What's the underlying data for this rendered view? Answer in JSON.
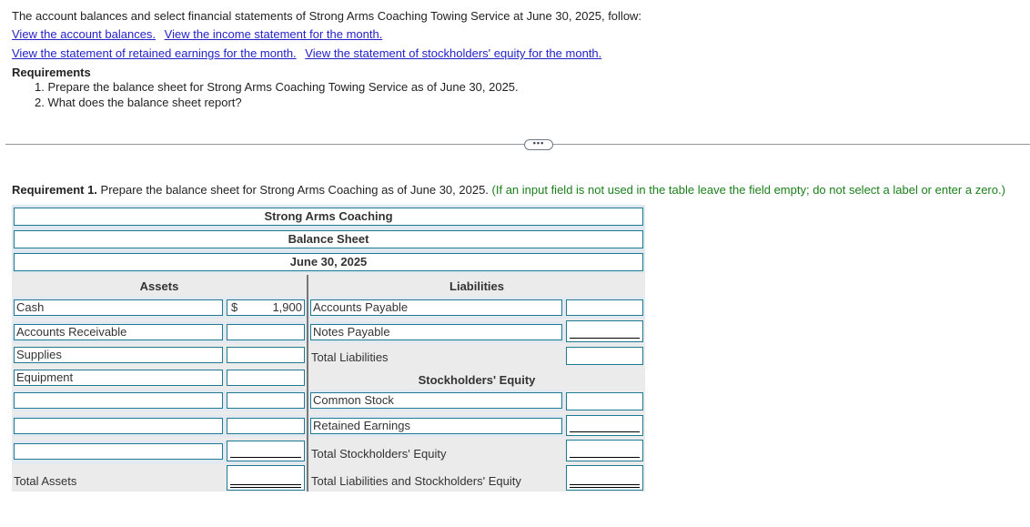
{
  "intro": {
    "text": "The account balances and select financial statements of Strong Arms Coaching Towing Service at June 30, 2025, follow:",
    "links": [
      "View the account balances.",
      "View the income statement for the month.",
      "View the statement of retained earnings for the month.",
      "View the statement of stockholders' equity for the month."
    ]
  },
  "requirements": {
    "title": "Requirements",
    "items": [
      "1. Prepare the balance sheet for Strong Arms Coaching Towing Service as of June 30, 2025.",
      "2. What does the balance sheet report?"
    ]
  },
  "more_button": {
    "icon": "ellipsis-icon",
    "label": "•••"
  },
  "requirement1": {
    "bold": "Requirement 1.",
    "text": " Prepare the balance sheet for Strong Arms Coaching as of June 30, 2025.",
    "hint": " (If an input field is not used in the table leave the field empty; do not select a label or enter a zero.)"
  },
  "sheet": {
    "company": "Strong Arms Coaching",
    "title": "Balance Sheet",
    "date": "June 30, 2025",
    "assets_heading": "Assets",
    "liabilities_heading": "Liabilities",
    "equity_heading": "Stockholders' Equity",
    "assets": [
      {
        "label": "Cash",
        "currency": "$",
        "value": "1,900"
      },
      {
        "label": "Accounts Receivable",
        "currency": "",
        "value": ""
      },
      {
        "label": "Supplies",
        "currency": "",
        "value": ""
      },
      {
        "label": "Equipment",
        "currency": "",
        "value": ""
      },
      {
        "label": "",
        "currency": "",
        "value": ""
      },
      {
        "label": "",
        "currency": "",
        "value": ""
      },
      {
        "label": "",
        "currency": "",
        "value": ""
      }
    ],
    "total_assets_label": "Total Assets",
    "total_assets_value": "",
    "liabilities": [
      {
        "label": "Accounts Payable",
        "value": ""
      },
      {
        "label": "Notes Payable",
        "value": ""
      }
    ],
    "total_liabilities_label": "Total Liabilities",
    "total_liabilities_value": "",
    "equity": [
      {
        "label": "Common Stock",
        "value": ""
      },
      {
        "label": "Retained Earnings",
        "value": ""
      }
    ],
    "total_equity_label": "Total Stockholders' Equity",
    "total_equity_value": "",
    "total_liab_equity_label": "Total Liabilities and Stockholders' Equity",
    "total_liab_equity_value": ""
  }
}
